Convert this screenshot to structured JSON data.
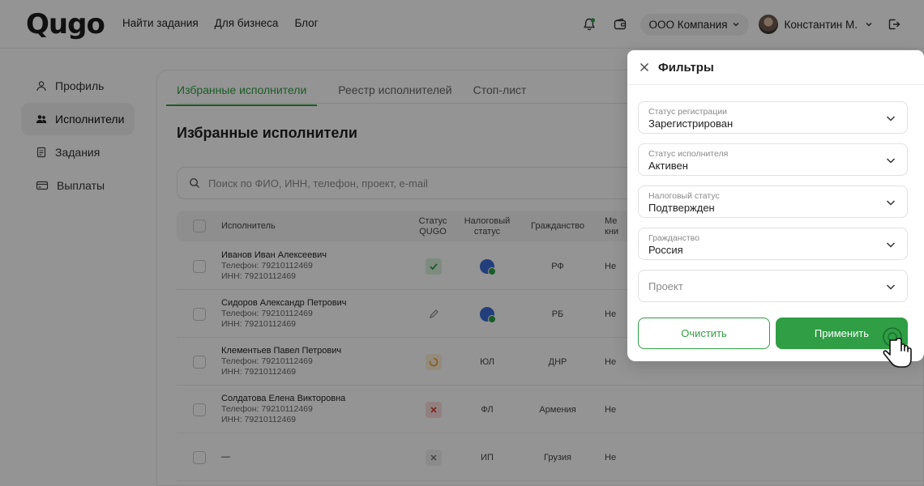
{
  "header": {
    "logo": "Qugo",
    "nav": [
      "Найти задания",
      "Для бизнеса",
      "Блог"
    ],
    "company": "ООО Компания",
    "user": "Константин М."
  },
  "sidebar": {
    "items": [
      {
        "label": "Профиль",
        "icon": "user-icon"
      },
      {
        "label": "Исполнители",
        "icon": "users-icon",
        "active": true
      },
      {
        "label": "Задания",
        "icon": "document-icon"
      },
      {
        "label": "Выплаты",
        "icon": "card-icon"
      }
    ]
  },
  "main": {
    "tabs": [
      {
        "label": "Избранные исполнители",
        "active": true
      },
      {
        "label": "Реестр исполнителей"
      },
      {
        "label": "Стоп-лист"
      }
    ],
    "title": "Избранные исполнители",
    "search_placeholder": "Поиск по ФИО, ИНН, телефон, проект, e-mail",
    "columns": {
      "performer": "Исполнитель",
      "status_qugo_1": "Статус",
      "status_qugo_2": "QUGO",
      "tax_1": "Налоговый",
      "tax_2": "статус",
      "citizenship": "Гражданство",
      "med_1": "Ме",
      "med_2": "кни"
    },
    "rows": [
      {
        "name": "Иванов Иван Алексеевич",
        "phone": "Телефон: 79210112469",
        "inn": "ИНН: 79210112469",
        "qugo": "check",
        "tax": "icon",
        "citizenship": "РФ",
        "med": "Не"
      },
      {
        "name": "Сидоров Александр Петрович",
        "phone": "Телефон: 79210112469",
        "inn": "ИНН: 79210112469",
        "qugo": "pencil",
        "tax": "icon",
        "citizenship": "РБ",
        "med": "Не"
      },
      {
        "name": "Клементьев Павел Петрович",
        "phone": "Телефон: 79210112469",
        "inn": "ИНН: 79210112469",
        "qugo": "loading",
        "tax": "ЮЛ",
        "citizenship": "ДНР",
        "med": "Не"
      },
      {
        "name": "Солдатова Елена Викторовна",
        "phone": "Телефон: 79210112469",
        "inn": "ИНН: 79210112469",
        "qugo": "cross",
        "tax": "ФЛ",
        "citizenship": "Армения",
        "med": "Не"
      },
      {
        "name": "—",
        "phone": "",
        "inn": "",
        "qugo": "x-grey",
        "tax": "ИП",
        "citizenship": "Грузия",
        "med": "Не"
      }
    ]
  },
  "filters": {
    "title": "Фильтры",
    "fields": [
      {
        "label": "Статус регистрации",
        "value": "Зарегистрирован"
      },
      {
        "label": "Статус исполнителя",
        "value": "Активен"
      },
      {
        "label": "Налоговый статус",
        "value": "Подтвержден"
      },
      {
        "label": "Гражданство",
        "value": "Россия"
      },
      {
        "placeholder": "Проект"
      }
    ],
    "clear_label": "Очистить",
    "apply_label": "Применить"
  },
  "colors": {
    "accent": "#2f9e44",
    "overlay": "rgba(0,0,0,0.42)"
  }
}
